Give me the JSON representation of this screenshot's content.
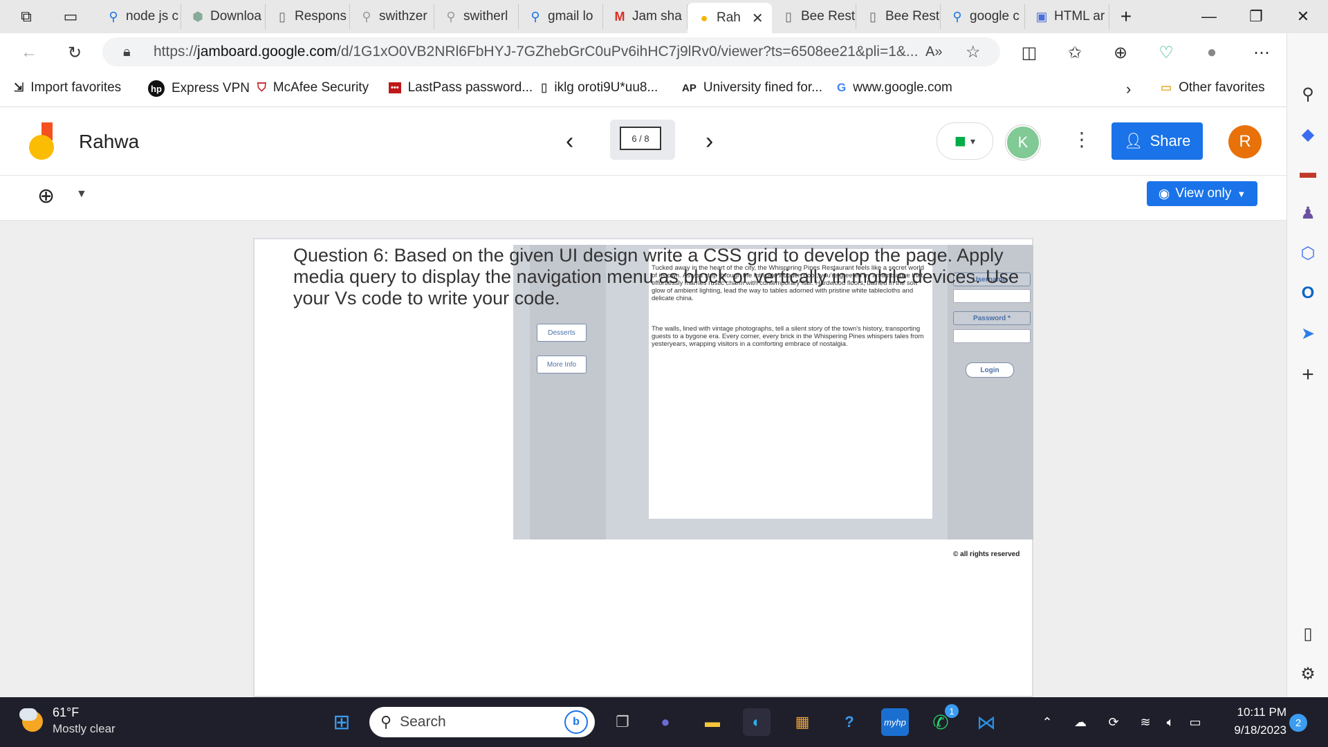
{
  "browser": {
    "tabs": [
      {
        "label": "node js c",
        "icon": "search-icon"
      },
      {
        "label": "Downloa",
        "icon": "hexagon-icon"
      },
      {
        "label": "Respons",
        "icon": "page-icon"
      },
      {
        "label": "swithzer",
        "icon": "search-icon"
      },
      {
        "label": "switherl",
        "icon": "search-icon"
      },
      {
        "label": "gmail lo",
        "icon": "search-icon"
      },
      {
        "label": "Jam sha",
        "icon": "gmail-icon"
      },
      {
        "label": "Rah",
        "icon": "jamboard-icon",
        "active": true
      },
      {
        "label": "Bee Rest",
        "icon": "page-icon"
      },
      {
        "label": "Bee Rest",
        "icon": "page-icon"
      },
      {
        "label": "google c",
        "icon": "search-icon"
      },
      {
        "label": "HTML ar",
        "icon": "profile-icon"
      }
    ],
    "url_prefix": "https://",
    "url_host": "jamboard.google.com",
    "url_path": "/d/1G1xO0VB2NRl6FbHYJ-7GZhebGrC0uPv6ihHC7j9lRv0/viewer?ts=6508ee21&pli=1&...",
    "favorites": [
      {
        "label": "Import favorites",
        "icon": "import-icon"
      },
      {
        "label": "Express VPN",
        "icon": "hp-icon"
      },
      {
        "label": "McAfee Security",
        "icon": "mcafee-icon"
      },
      {
        "label": "LastPass password...",
        "icon": "lastpass-icon"
      },
      {
        "label": "iklg oroti9U*uu8...",
        "icon": "page-icon"
      },
      {
        "label": "University fined for...",
        "icon": "ap-icon"
      },
      {
        "label": "www.google.com",
        "icon": "google-icon"
      }
    ],
    "other_favorites": "Other favorites"
  },
  "jamboard": {
    "title": "Rahwa",
    "page_indicator": "6 / 8",
    "avatar_k": "K",
    "avatar_r": "R",
    "share_label": "Share",
    "view_only_label": "View only",
    "question": "Question 6: Based on the given UI design write a CSS grid to develop the page. Apply media query to display the navigation menu as block or vertically in mobile devices. Use your Vs code to write your code.",
    "design": {
      "nav": [
        "Desserts",
        "More Info"
      ],
      "para1": "Tucked away in the heart of the city, the Whispering Pines Restaurant feels like a secret world of its own. As you step through the intricate wooden door, you're greeted by an ambiance that effortlessly marries rustic charm with contemporary flair. Hardwood floors, bathed in the soft glow of ambient lighting, lead the way to tables adorned with pristine white tablecloths and delicate china.",
      "para2": "The walls, lined with vintage photographs, tell a silent story of the town's history, transporting guests to a bygone era. Every corner, every brick in the Whispering Pines whispers tales from yesteryears, wrapping visitors in a comforting embrace of nostalgia.",
      "username_label": "Username *",
      "password_label": "Password *",
      "login_label": "Login",
      "footer": "all rights reserved",
      "footer_symbol": "©"
    }
  },
  "taskbar": {
    "weather_temp": "61°F",
    "weather_desc": "Mostly clear",
    "search_placeholder": "Search",
    "time": "10:11 PM",
    "date": "9/18/2023",
    "notification_count": "2",
    "whatsapp_badge": "1"
  },
  "colors": {
    "share_blue": "#1a73e8",
    "avatar_k": "#81c995",
    "avatar_r": "#e8710a",
    "taskbar_bg": "#1f1f2b"
  }
}
